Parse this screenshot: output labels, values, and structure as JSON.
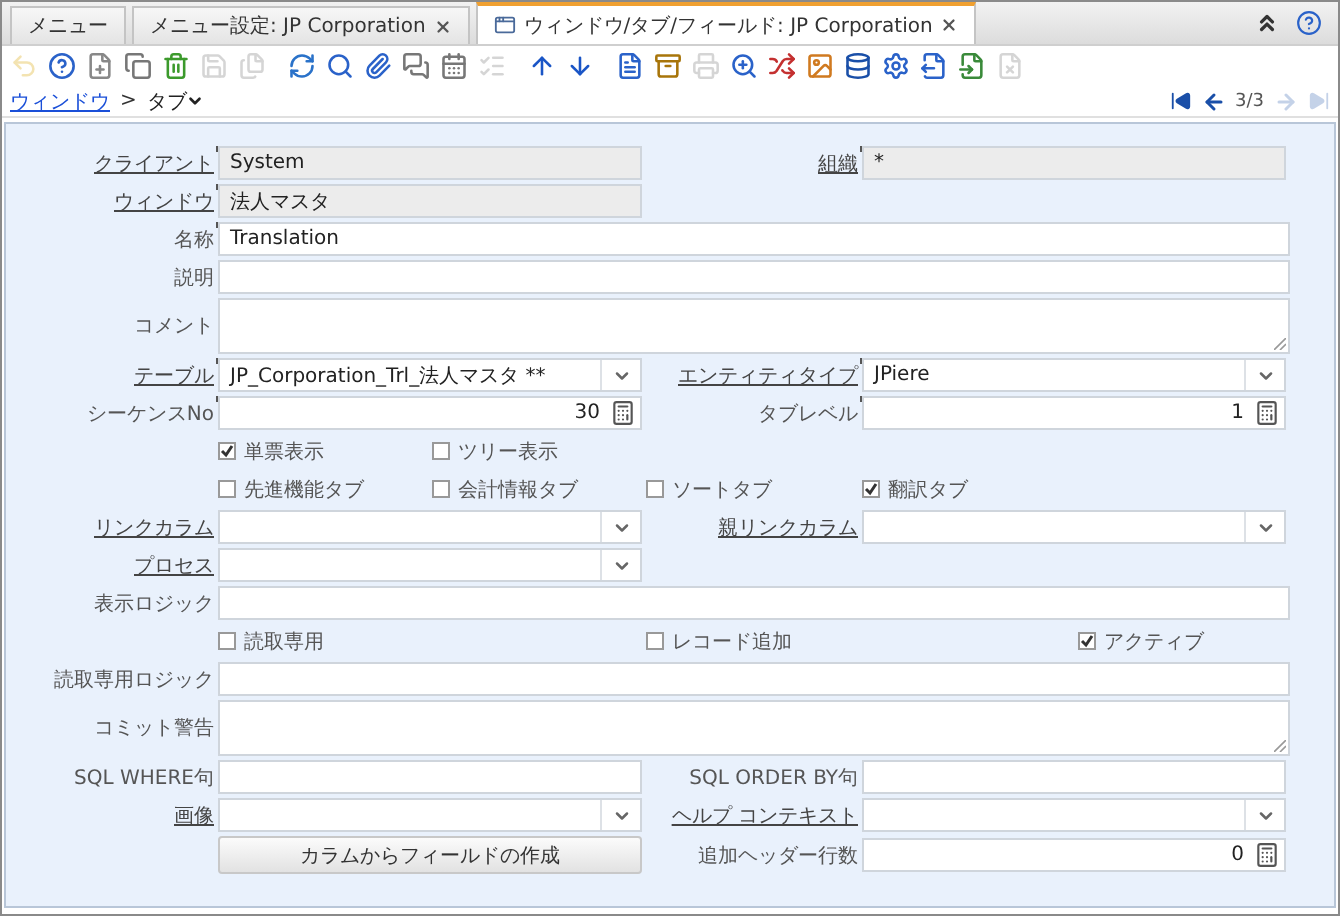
{
  "tabs": [
    {
      "label": "メニュー",
      "selected": false,
      "closable": false,
      "icon": false
    },
    {
      "label": "メニュー設定: JP Corporation",
      "selected": false,
      "closable": true,
      "icon": false
    },
    {
      "label": "ウィンドウ/タブ/フィールド: JP Corporation",
      "selected": true,
      "closable": true,
      "icon": true
    }
  ],
  "toolbar": [
    {
      "disabled": true
    },
    {
      "disabled": false
    },
    {
      "disabled": false
    },
    {
      "disabled": false
    },
    {
      "disabled": false
    },
    {
      "disabled": true
    },
    {
      "disabled": true
    },
    {
      "disabled": false
    },
    {
      "disabled": false
    },
    {
      "disabled": false
    },
    {
      "disabled": false
    },
    {
      "disabled": false
    },
    {
      "disabled": true
    },
    {
      "disabled": false
    },
    {
      "disabled": false
    },
    {
      "disabled": false
    },
    {
      "disabled": false
    },
    {
      "disabled": true
    },
    {
      "disabled": false
    },
    {
      "disabled": false
    },
    {
      "disabled": false
    },
    {
      "disabled": false
    },
    {
      "disabled": false
    },
    {
      "disabled": false
    },
    {
      "disabled": false
    },
    {
      "disabled": true
    }
  ],
  "breadcrumb": {
    "parent": "ウィンドウ",
    "separator": ">",
    "current": "タブ"
  },
  "navigation": {
    "first_disabled": false,
    "previous_disabled": false,
    "position": "3/3",
    "next_disabled": true,
    "last_disabled": true
  },
  "form": [
    {
      "kind": "fields",
      "items": [
        {
          "kind": "text_field",
          "label": "クライアント",
          "link": true,
          "required": true,
          "readonly": true,
          "value": "System",
          "full": false
        },
        {
          "kind": "text_field",
          "label": "組織",
          "link": true,
          "required": true,
          "readonly": true,
          "value": "*",
          "full": false
        }
      ]
    },
    {
      "kind": "fields",
      "items": [
        {
          "kind": "text_field",
          "label": "ウィンドウ",
          "link": true,
          "required": true,
          "readonly": true,
          "value": "法人マスタ",
          "full": false
        }
      ]
    },
    {
      "kind": "fields",
      "items": [
        {
          "kind": "text_field",
          "label": "名称",
          "link": false,
          "required": true,
          "readonly": false,
          "value": "Translation",
          "full": true
        }
      ]
    },
    {
      "kind": "fields",
      "items": [
        {
          "kind": "text_field",
          "label": "説明",
          "link": false,
          "required": false,
          "readonly": false,
          "full": true
        }
      ]
    },
    {
      "kind": "fields",
      "items": [
        {
          "kind": "text_area",
          "label": "コメント",
          "link": false,
          "required": false,
          "readonly": false,
          "full": true
        }
      ]
    },
    {
      "kind": "fields",
      "items": [
        {
          "kind": "combo_field",
          "label": "テーブル",
          "link": true,
          "required": true,
          "readonly": false,
          "value": "JP_Corporation_Trl_法人マスタ **",
          "full": false
        },
        {
          "kind": "combo_field",
          "label": "エンティティタイプ",
          "link": true,
          "required": true,
          "readonly": false,
          "value": "JPiere",
          "full": false
        }
      ]
    },
    {
      "kind": "fields",
      "items": [
        {
          "kind": "number_field",
          "label": "シーケンスNo",
          "link": false,
          "required": true,
          "readonly": false,
          "value": "30",
          "full": false
        },
        {
          "kind": "number_field",
          "label": "タブレベル",
          "link": false,
          "required": true,
          "readonly": false,
          "value": "1",
          "full": false
        }
      ]
    },
    {
      "kind": "checks",
      "slots": [
        {
          "kind": "checkbox",
          "label": "単票表示",
          "checked": true
        },
        {
          "kind": "checkbox",
          "label": "ツリー表示",
          "checked": false
        }
      ]
    },
    {
      "kind": "checks",
      "slots": [
        {
          "kind": "checkbox",
          "label": "先進機能タブ",
          "checked": false
        },
        {
          "kind": "checkbox",
          "label": "会計情報タブ",
          "checked": false
        },
        {
          "kind": "checkbox",
          "label": "ソートタブ",
          "checked": false
        },
        {
          "kind": "checkbox",
          "label": "翻訳タブ",
          "checked": true
        }
      ]
    },
    {
      "kind": "fields",
      "items": [
        {
          "kind": "combo_field",
          "label": "リンクカラム",
          "link": true,
          "required": false,
          "readonly": false,
          "full": false
        },
        {
          "kind": "combo_field",
          "label": "親リンクカラム",
          "link": true,
          "required": false,
          "readonly": false,
          "full": false
        }
      ]
    },
    {
      "kind": "fields",
      "items": [
        {
          "kind": "combo_field",
          "label": "プロセス",
          "link": true,
          "required": false,
          "readonly": false,
          "full": false
        }
      ]
    },
    {
      "kind": "fields",
      "items": [
        {
          "kind": "text_field",
          "label": "表示ロジック",
          "link": false,
          "required": false,
          "readonly": false,
          "full": true
        }
      ]
    },
    {
      "kind": "checks",
      "slots": [
        {
          "kind": "checkbox",
          "label": "読取専用",
          "checked": false
        },
        {
          "kind": "gap"
        },
        {
          "kind": "checkbox",
          "label": "レコード追加",
          "checked": false
        },
        {
          "kind": "gap"
        },
        {
          "kind": "checkbox",
          "label": "アクティブ",
          "checked": true
        }
      ]
    },
    {
      "kind": "fields",
      "items": [
        {
          "kind": "text_field",
          "label": "読取専用ロジック",
          "link": false,
          "required": false,
          "readonly": false,
          "full": true
        }
      ]
    },
    {
      "kind": "fields",
      "items": [
        {
          "kind": "text_area",
          "label": "コミット警告",
          "link": false,
          "required": false,
          "readonly": false,
          "full": true
        }
      ]
    },
    {
      "kind": "fields",
      "items": [
        {
          "kind": "text_field",
          "label": "SQL WHERE句",
          "link": false,
          "required": false,
          "readonly": false,
          "full": false
        },
        {
          "kind": "text_field",
          "label": "SQL ORDER BY句",
          "link": false,
          "required": false,
          "readonly": false,
          "full": false
        }
      ]
    },
    {
      "kind": "fields",
      "items": [
        {
          "kind": "combo_field",
          "label": "画像",
          "link": true,
          "required": false,
          "readonly": false,
          "full": false
        },
        {
          "kind": "combo_field",
          "label": "ヘルプ コンテキスト",
          "link": true,
          "required": false,
          "readonly": false,
          "full": false
        }
      ]
    },
    {
      "kind": "fields",
      "items": [
        {
          "kind": "button",
          "label": "カラムからフィールドの作成"
        },
        {
          "kind": "number_field",
          "label": "追加ヘッダー行数",
          "link": false,
          "required": false,
          "readonly": false,
          "value": "0",
          "full": false
        }
      ]
    }
  ]
}
